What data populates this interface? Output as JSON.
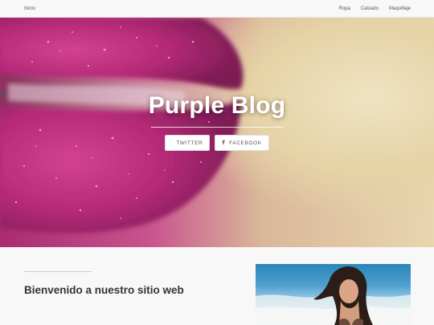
{
  "navbar": {
    "brand": "Inicio",
    "links": [
      "Ropa",
      "Calzado",
      "Maquillaje"
    ]
  },
  "hero": {
    "title": "Purple Blog",
    "buttons": [
      {
        "label": "TWITTER",
        "icon": "twitter-icon",
        "glyph": "🐦"
      },
      {
        "label": "FACEBOOK",
        "icon": "facebook-icon",
        "glyph": "f"
      }
    ]
  },
  "content": {
    "heading": "Bienvenido a nuestro sitio web"
  },
  "colors": {
    "lips": "#b8327f",
    "hero_bg": "#e8d6ae",
    "navbar_bg": "#f8f8f8"
  }
}
